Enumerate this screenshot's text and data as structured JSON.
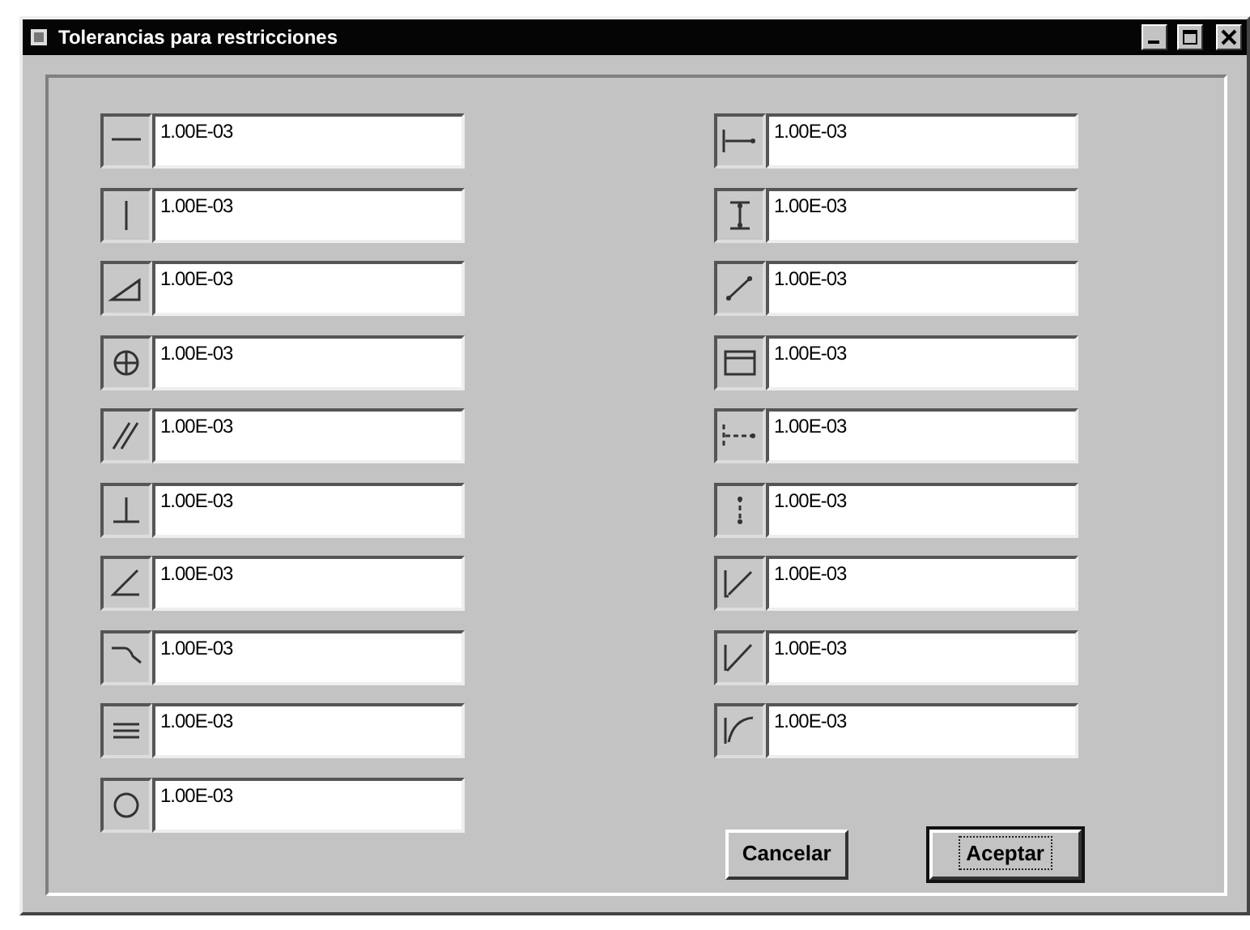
{
  "window": {
    "title": "Tolerancias para restricciones"
  },
  "left_fields": [
    {
      "kind": "horizontal",
      "value": "1.00E-03"
    },
    {
      "kind": "vertical",
      "value": "1.00E-03"
    },
    {
      "kind": "angle",
      "value": "1.00E-03"
    },
    {
      "kind": "concentric",
      "value": "1.00E-03"
    },
    {
      "kind": "parallel",
      "value": "1.00E-03"
    },
    {
      "kind": "perpendicular",
      "value": "1.00E-03"
    },
    {
      "kind": "corner",
      "value": "1.00E-03"
    },
    {
      "kind": "tangent",
      "value": "1.00E-03"
    },
    {
      "kind": "lines",
      "value": "1.00E-03"
    },
    {
      "kind": "symmetric",
      "value": "1.00E-03"
    }
  ],
  "right_fields": [
    {
      "kind": "h-distance",
      "value": "1.00E-03"
    },
    {
      "kind": "v-distance",
      "value": "1.00E-03"
    },
    {
      "kind": "aligned-distance",
      "value": "1.00E-03"
    },
    {
      "kind": "box",
      "value": "1.00E-03"
    },
    {
      "kind": "h-dashed",
      "value": "1.00E-03"
    },
    {
      "kind": "v-dashed",
      "value": "1.00E-03"
    },
    {
      "kind": "radius",
      "value": "1.00E-03"
    },
    {
      "kind": "diameter",
      "value": "1.00E-03"
    },
    {
      "kind": "arc",
      "value": "1.00E-03"
    }
  ],
  "buttons": [
    {
      "label": "Cancelar",
      "default": false
    },
    {
      "label": "Aceptar",
      "default": true
    }
  ]
}
